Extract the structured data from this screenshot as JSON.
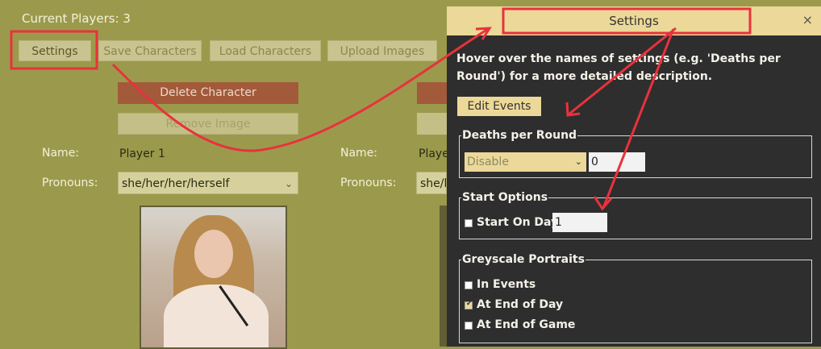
{
  "header": {
    "players_count": "Current Players: 3"
  },
  "toolbar": {
    "settings": "Settings",
    "save": "Save Characters",
    "load": "Load Characters",
    "upload": "Upload Images"
  },
  "player1": {
    "delete": "Delete Character",
    "remove_image": "Remove Image",
    "name_label": "Name:",
    "name_value": "Player 1",
    "pronouns_label": "Pronouns:",
    "pronouns_value": "she/her/her/herself",
    "portrait_icon": "portrait-photo"
  },
  "player2": {
    "name_label": "Name:",
    "name_value": "Playe",
    "pronouns_label": "Pronouns:",
    "pronouns_value": "she/h"
  },
  "settings": {
    "title": "Settings",
    "close": "×",
    "description": "Hover over the names of settings (e.g. 'Deaths per Round') for a more detailed description.",
    "edit_events": "Edit Events",
    "deaths_per_round": {
      "legend": "Deaths per Round",
      "mode": "Disable",
      "value": "0"
    },
    "start_options": {
      "legend": "Start Options",
      "start_on_day_label": "Start On Day",
      "start_on_day_value": "1",
      "checked": false
    },
    "greyscale": {
      "legend": "Greyscale Portraits",
      "items": [
        {
          "label": "In Events",
          "checked": false
        },
        {
          "label": "At End of Day",
          "checked": true
        },
        {
          "label": "At End of Game",
          "checked": false
        }
      ]
    }
  },
  "colors": {
    "annotation": "#e8323c",
    "accent": "#ecd898",
    "dialog_bg": "#2e2e2e",
    "page_bg": "#9b9a4c"
  }
}
